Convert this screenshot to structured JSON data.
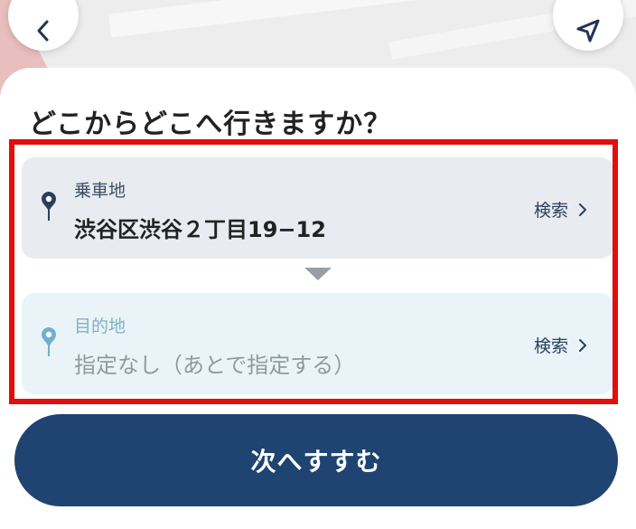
{
  "header": {
    "title": "どこからどこへ行きますか？"
  },
  "pickup": {
    "label": "乗車地",
    "value": "渋谷区渋谷２丁目19−12",
    "search_label": "検索"
  },
  "destination": {
    "label": "目的地",
    "placeholder": "指定なし（あとで指定する）",
    "search_label": "検索"
  },
  "footer": {
    "next_label": "次へすすむ"
  },
  "colors": {
    "accent": "#1f4472",
    "highlight": "#e30d0d",
    "pickup_pin": "#2b3f5c",
    "destination_pin": "#6fb0d0"
  },
  "icons": {
    "back": "chevron-left-icon",
    "current_location": "navigation-arrow-icon",
    "pickup_pin": "map-pin-icon",
    "destination_pin": "map-pin-icon",
    "search_chevron": "chevron-right-icon",
    "swap": "triangle-down-icon"
  }
}
